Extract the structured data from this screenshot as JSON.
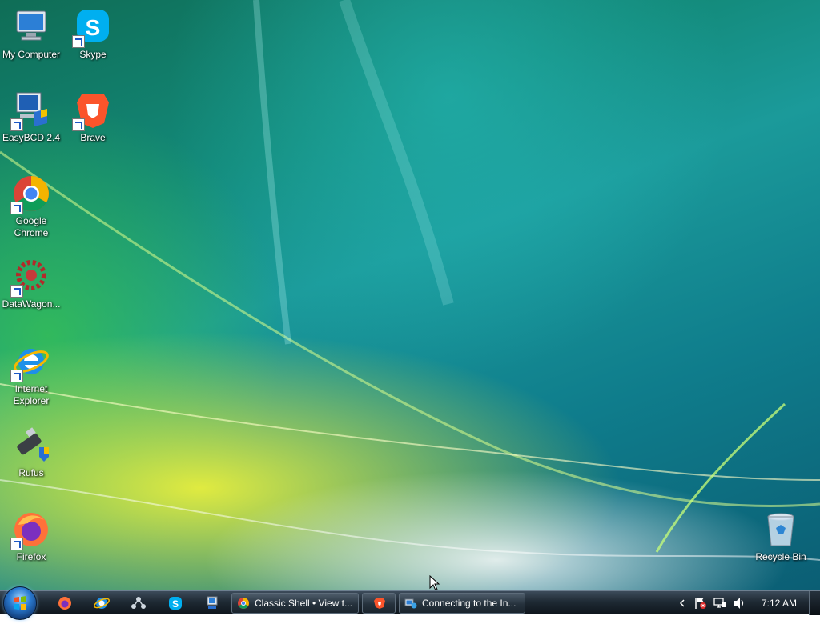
{
  "desktop": {
    "icons": [
      {
        "label": "My Computer"
      },
      {
        "label": "Skype"
      },
      {
        "label": "EasyBCD 2.4"
      },
      {
        "label": "Brave"
      },
      {
        "label": "Google Chrome"
      },
      {
        "label": "DataWagon..."
      },
      {
        "label": "Internet Explorer"
      },
      {
        "label": "Rufus"
      },
      {
        "label": "Firefox"
      },
      {
        "label": "Recycle Bin"
      }
    ]
  },
  "taskbar": {
    "tasks": [
      {
        "label": "Classic Shell • View t...",
        "icon": "chrome-icon"
      },
      {
        "label": "",
        "icon": "brave-icon"
      },
      {
        "label": "Connecting to the In...",
        "icon": "network-icon"
      }
    ],
    "quick_launch": [
      "firefox-icon",
      "internet-explorer-icon",
      "network-icon",
      "skype-icon",
      "device-icon"
    ],
    "tray": {
      "clock": "7:12 AM"
    }
  }
}
